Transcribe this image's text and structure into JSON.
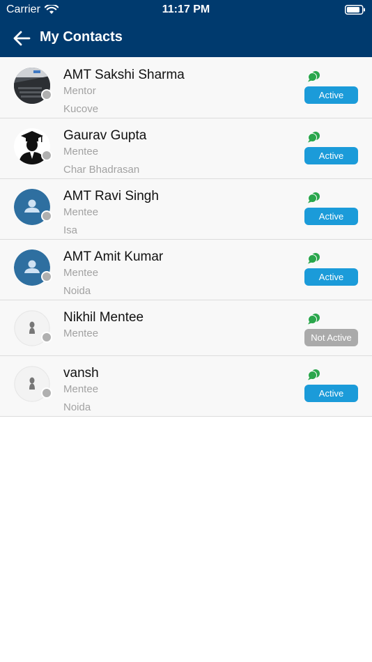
{
  "status_bar": {
    "carrier": "Carrier",
    "time": "11:17 PM"
  },
  "header": {
    "title": "My Contacts"
  },
  "contacts": [
    {
      "name": "AMT Sakshi Sharma",
      "role": "Mentor",
      "place": "Kucove",
      "status": "Active",
      "avatar": "photo-avatar"
    },
    {
      "name": "Gaurav Gupta",
      "role": "Mentee",
      "place": "Char Bhadrasan",
      "status": "Active",
      "avatar": "graduate-avatar"
    },
    {
      "name": "AMT Ravi Singh",
      "role": "Mentee",
      "place": "Isa",
      "status": "Active",
      "avatar": "default-user-avatar"
    },
    {
      "name": "AMT Amit Kumar",
      "role": "Mentee",
      "place": "Noida",
      "status": "Active",
      "avatar": "default-user-avatar"
    },
    {
      "name": "Nikhil Mentee",
      "role": "Mentee",
      "place": "",
      "status": "Not Active",
      "avatar": "silhouette-avatar"
    },
    {
      "name": "vansh",
      "role": "Mentee",
      "place": "Noida",
      "status": "Active",
      "avatar": "silhouette-avatar"
    }
  ],
  "colors": {
    "header": "#003a6e",
    "active": "#1b9bd9",
    "inactive": "#aaaaaa",
    "chat": "#2aa64c",
    "avatar_blue": "#2e6fa0"
  }
}
